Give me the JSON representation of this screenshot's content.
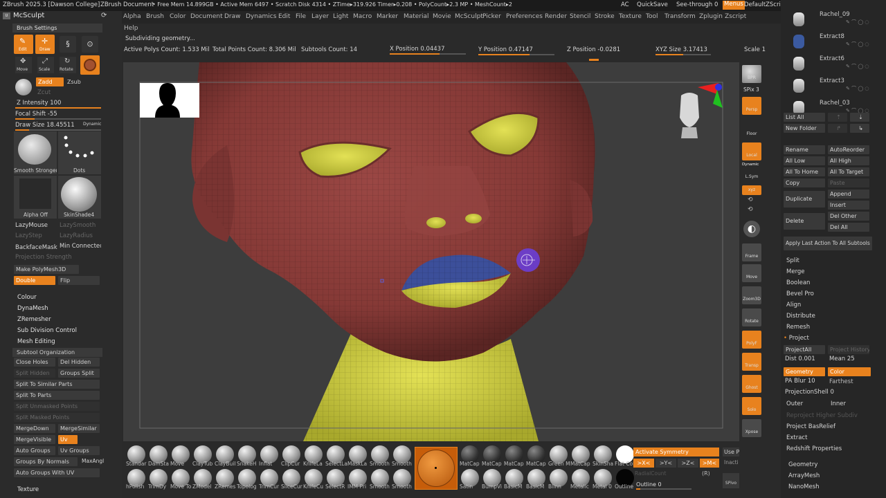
{
  "titlebar": {
    "app_title": "ZBrush 2025.3 [Dawson College]",
    "document": "ZBrush Document",
    "stats": "• Free Mem 14.899GB • Active Mem 6497 • Scratch Disk 4314 • ZTime▸319.926 Timer▸0.208 • PolyCount▸2.3 MP • MeshCount▸2",
    "ac": "AC",
    "quicksave": "QuickSave",
    "seethrough": "See-through  0",
    "menus": "Menus",
    "default_script": "DefaultZScript"
  },
  "menus": [
    "Alpha",
    "Brush",
    "Color",
    "Document",
    "Draw",
    "Dynamics",
    "Edit",
    "File",
    "Layer",
    "Light",
    "Macro",
    "Marker",
    "Material",
    "Movie",
    "McSculpt",
    "Picker",
    "Preferences",
    "Render",
    "Stencil",
    "Stroke",
    "Texture",
    "Tool",
    "Transform",
    "Zplugin",
    "Zscript",
    "Help"
  ],
  "status": {
    "subdividing": "Subdividing geometry...",
    "active_polys": "Active Polys Count: 1.533 Mil",
    "total_points": "Total Points Count: 8.306 Mil",
    "subtools": "Subtools Count: 14",
    "x_pos_label": "X Position",
    "x_pos": "0.04437",
    "y_pos_label": "Y Position",
    "y_pos": "0.47147",
    "z_pos_label": "Z Position",
    "z_pos": "-0.0281",
    "xyz_label": "XYZ Size",
    "xyz": "3.17413",
    "scale_label": "Scale",
    "scale": "1"
  },
  "left": {
    "palette_title": "McSculpt",
    "brush_settings": "Brush Settings",
    "edit": "Edit",
    "draw": "Draw",
    "move": "Move",
    "scale": "Scale",
    "rotate": "Rotate",
    "zadd": "Zadd",
    "zsub": "Zsub",
    "zcut": "Zcut",
    "z_intensity_label": "Z Intensity",
    "z_intensity": "100",
    "focal_shift_label": "Focal Shift",
    "focal_shift": "-55",
    "draw_size_label": "Draw Size",
    "draw_size": "18.45511",
    "dynamic": "Dynamic",
    "brush1": "Smooth Stronger",
    "brush2": "Dots",
    "alpha": "Alpha Off",
    "material": "SkinShade4",
    "lazymouse": "LazyMouse",
    "lazysmooth": "LazySmooth",
    "lazystep": "LazyStep",
    "lazyradius": "LazyRadius",
    "backfacemask": "BackfaceMask",
    "min_connected": "Min Connected",
    "projection_strength": "Projection Strength",
    "make_polymesh": "Make PolyMesh3D",
    "double": "Double",
    "flip": "Flip",
    "colour": "Colour",
    "dynamesh": "DynaMesh",
    "zremesher": "ZRemesher",
    "subdivision": "Sub Division Control",
    "mesh_editing": "Mesh Editing",
    "subtool_org": "Subtool Organization",
    "close_holes": "Close Holes",
    "del_hidden": "Del Hidden",
    "split_hidden": "Split Hidden",
    "groups_split": "Groups Split",
    "split_similar": "Split To Similar Parts",
    "split_parts": "Split To Parts",
    "split_unmasked": "Split Unmasked Points",
    "split_masked": "Split Masked Points",
    "merge_down": "MergeDown",
    "merge_similar": "MergeSimilar",
    "merge_visible": "MergeVisible",
    "uv": "Uv",
    "auto_groups": "Auto Groups",
    "uv_groups": "Uv Groups",
    "groups_by_normals": "Groups By Normals",
    "max_angle": "MaxAngl",
    "auto_groups_uv": "Auto Groups With UV",
    "texture": "Texture"
  },
  "rightstrip": {
    "bpr": "BPR",
    "spix_label": "SPix",
    "spix": "3",
    "persp": "Persp",
    "floor": "Floor",
    "local": "Local",
    "dynamic": "Dynamic",
    "lsym": "L.Sym",
    "xyz": "xyz",
    "frame": "Frame",
    "move": "Move",
    "zoom3d": "Zoom3D",
    "rotate": "Rotate",
    "polyf": "PolyF",
    "transp": "Transp",
    "ghost": "Ghost",
    "solo": "Solo",
    "xpose": "Xpose"
  },
  "right": {
    "subtools": [
      "Rachel_09",
      "Extract8",
      "Extract6",
      "Extract3",
      "Rachel_03"
    ],
    "list_all": "List All",
    "new_folder": "New Folder",
    "rename": "Rename",
    "autoreorder": "AutoReorder",
    "all_low": "All Low",
    "all_high": "All High",
    "all_to_home": "All To Home",
    "all_to_target": "All To Target",
    "copy": "Copy",
    "paste": "Paste",
    "duplicate": "Duplicate",
    "append": "Append",
    "insert": "Insert",
    "delete": "Delete",
    "del_other": "Del Other",
    "del_all": "Del All",
    "apply_last": "Apply Last Action To All Subtools",
    "split": "Split",
    "merge": "Merge",
    "boolean": "Boolean",
    "bevel_pro": "Bevel Pro",
    "align": "Align",
    "distribute": "Distribute",
    "remesh": "Remesh",
    "project": "Project",
    "project_all": "ProjectAll",
    "project_history": "Project History",
    "dist_label": "Dist",
    "dist": "0.001",
    "mean_label": "Mean",
    "mean": "25",
    "geometry": "Geometry",
    "color": "Color",
    "pa_blur_label": "PA Blur",
    "pa_blur": "10",
    "farthest": "Farthest",
    "projection_shell_label": "ProjectionShell",
    "projection_shell": "0",
    "outer": "Outer",
    "inner": "Inner",
    "reproject": "Reproject Higher Subdiv",
    "project_basrelief": "Project BasRelief",
    "extract": "Extract",
    "redshift": "Redshift Properties",
    "geometry2": "Geometry",
    "arraymesh": "ArrayMesh",
    "nanomesh": "NanoMesh"
  },
  "bottom": {
    "brushes_top": [
      "Standar",
      "DamSta",
      "Move",
      "ClayTub",
      "ClayBuil",
      "SnakeH",
      "Inflat",
      "ClipCur",
      "KnifeLa",
      "SelectLa",
      "MaskLa",
      "Smooth",
      "Smooth"
    ],
    "brushes_bottom": [
      "hPolish",
      "TrimDy",
      "Move To",
      "ZModel",
      "ZRemes",
      "Topolog",
      "TrimCur",
      "SliceCur",
      "KnifeCu",
      "SelectR",
      "IMM Pri",
      "Smooth",
      "Smooth"
    ],
    "mats_top": [
      "MatCap",
      "MatCap",
      "MatCap",
      "MatCap",
      "Green M",
      "MatCap",
      "SkinSha",
      "Flat Col"
    ],
    "mats_bottom": [
      "Satin",
      "BumpVi",
      "BasicM",
      "BasicM",
      "Blinn",
      "Metalic",
      "Metal 0",
      "Outline"
    ],
    "activate_symmetry": "Activate Symmetry",
    "sym_x": ">X<",
    "sym_y": ">Y<",
    "sym_z": ">Z<",
    "sym_m": ">M<",
    "use_p": "Use P",
    "inact": "Inacti",
    "radial_count": "RadialCount",
    "r": "(R)",
    "outline_label": "Outline",
    "outline": "0",
    "spiv": "SPivo"
  },
  "colors": {
    "accent": "#e8821e",
    "skin": "#8a3b38",
    "yellow": "#cbcc3a",
    "blue": "#3c4f9a",
    "brush_cursor": "#6a40e0"
  }
}
